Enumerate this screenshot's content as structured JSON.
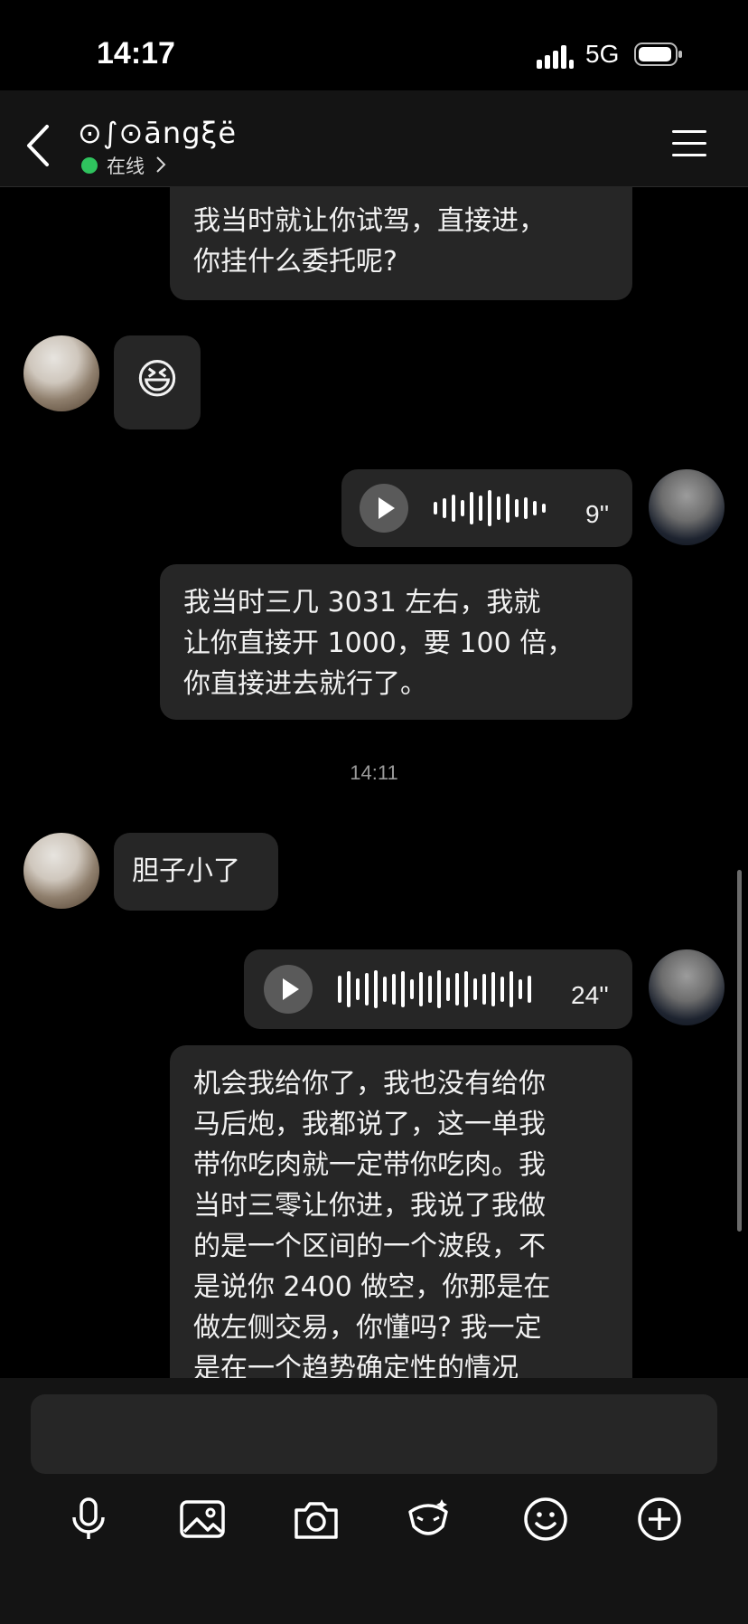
{
  "status_bar": {
    "time": "14:17",
    "network": "5G"
  },
  "header": {
    "title": "⊙∫⊙āngξë",
    "status": "在线"
  },
  "messages": {
    "m1": "我当时就让你试驾，直接进，\n你挂什么委托呢?",
    "m2_emoji": "😆",
    "v1_duration": "9''",
    "m3": "我当时三几 3031 左右，我就\n让你直接开 1000，要 100 倍，\n你直接进去就行了。",
    "timestamp": "14:11",
    "m4": "胆子小了",
    "v2_duration": "24''",
    "m5": "机会我给你了，我也没有给你\n马后炮，我都说了，这一单我\n带你吃肉就一定带你吃肉。我\n当时三零让你进，我说了我做\n的是一个区间的一个波段，不\n是说你 2400 做空，你那是在\n做左侧交易，你懂吗? 我一定\n是在一个趋势确定性的情况"
  },
  "toolbar": {
    "icons": [
      "microphone-icon",
      "image-icon",
      "camera-icon",
      "sticker-icon",
      "emoji-icon",
      "plus-icon"
    ]
  },
  "colors": {
    "background": "#000000",
    "bubble": "#262626",
    "online": "#2fc35e"
  }
}
